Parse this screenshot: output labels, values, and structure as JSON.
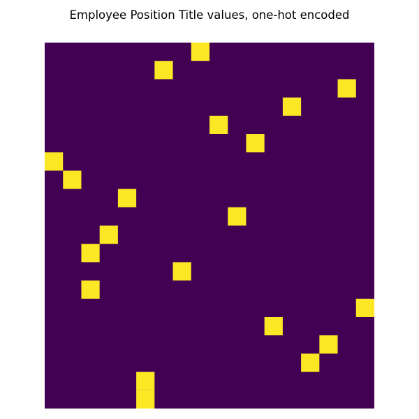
{
  "chart_data": {
    "type": "heatmap",
    "title": "Employee Position Title values, one-hot encoded",
    "xlabel": "",
    "ylabel": "",
    "n_rows": 20,
    "n_cols": 18,
    "value_range": [
      0,
      1
    ],
    "colors": {
      "zero": "#440154",
      "one": "#fde725"
    },
    "grid": false,
    "legend": "none",
    "hot_column_per_row": [
      8,
      6,
      16,
      13,
      9,
      11,
      0,
      1,
      4,
      10,
      3,
      2,
      7,
      2,
      17,
      12,
      15,
      14,
      5,
      5
    ]
  }
}
